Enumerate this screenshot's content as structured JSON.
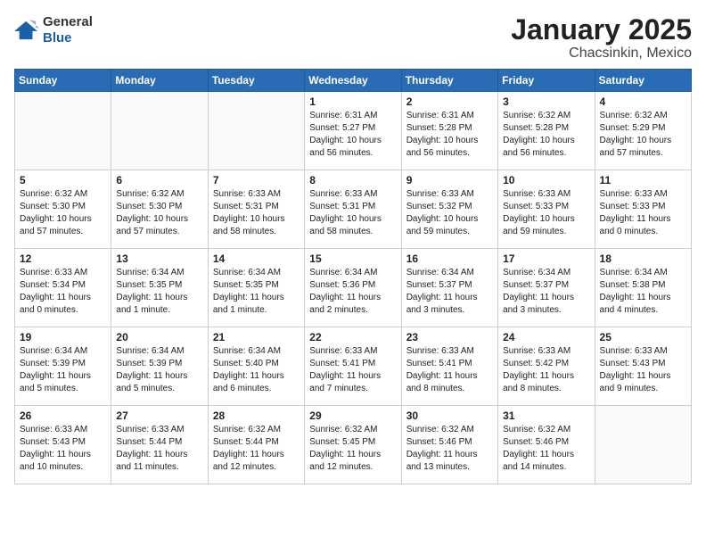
{
  "logo": {
    "general": "General",
    "blue": "Blue"
  },
  "header": {
    "month": "January 2025",
    "location": "Chacsinkin, Mexico"
  },
  "weekdays": [
    "Sunday",
    "Monday",
    "Tuesday",
    "Wednesday",
    "Thursday",
    "Friday",
    "Saturday"
  ],
  "weeks": [
    [
      {
        "day": "",
        "sunrise": "",
        "sunset": "",
        "daylight": ""
      },
      {
        "day": "",
        "sunrise": "",
        "sunset": "",
        "daylight": ""
      },
      {
        "day": "",
        "sunrise": "",
        "sunset": "",
        "daylight": ""
      },
      {
        "day": "1",
        "sunrise": "Sunrise: 6:31 AM",
        "sunset": "Sunset: 5:27 PM",
        "daylight": "Daylight: 10 hours and 56 minutes."
      },
      {
        "day": "2",
        "sunrise": "Sunrise: 6:31 AM",
        "sunset": "Sunset: 5:28 PM",
        "daylight": "Daylight: 10 hours and 56 minutes."
      },
      {
        "day": "3",
        "sunrise": "Sunrise: 6:32 AM",
        "sunset": "Sunset: 5:28 PM",
        "daylight": "Daylight: 10 hours and 56 minutes."
      },
      {
        "day": "4",
        "sunrise": "Sunrise: 6:32 AM",
        "sunset": "Sunset: 5:29 PM",
        "daylight": "Daylight: 10 hours and 57 minutes."
      }
    ],
    [
      {
        "day": "5",
        "sunrise": "Sunrise: 6:32 AM",
        "sunset": "Sunset: 5:30 PM",
        "daylight": "Daylight: 10 hours and 57 minutes."
      },
      {
        "day": "6",
        "sunrise": "Sunrise: 6:32 AM",
        "sunset": "Sunset: 5:30 PM",
        "daylight": "Daylight: 10 hours and 57 minutes."
      },
      {
        "day": "7",
        "sunrise": "Sunrise: 6:33 AM",
        "sunset": "Sunset: 5:31 PM",
        "daylight": "Daylight: 10 hours and 58 minutes."
      },
      {
        "day": "8",
        "sunrise": "Sunrise: 6:33 AM",
        "sunset": "Sunset: 5:31 PM",
        "daylight": "Daylight: 10 hours and 58 minutes."
      },
      {
        "day": "9",
        "sunrise": "Sunrise: 6:33 AM",
        "sunset": "Sunset: 5:32 PM",
        "daylight": "Daylight: 10 hours and 59 minutes."
      },
      {
        "day": "10",
        "sunrise": "Sunrise: 6:33 AM",
        "sunset": "Sunset: 5:33 PM",
        "daylight": "Daylight: 10 hours and 59 minutes."
      },
      {
        "day": "11",
        "sunrise": "Sunrise: 6:33 AM",
        "sunset": "Sunset: 5:33 PM",
        "daylight": "Daylight: 11 hours and 0 minutes."
      }
    ],
    [
      {
        "day": "12",
        "sunrise": "Sunrise: 6:33 AM",
        "sunset": "Sunset: 5:34 PM",
        "daylight": "Daylight: 11 hours and 0 minutes."
      },
      {
        "day": "13",
        "sunrise": "Sunrise: 6:34 AM",
        "sunset": "Sunset: 5:35 PM",
        "daylight": "Daylight: 11 hours and 1 minute."
      },
      {
        "day": "14",
        "sunrise": "Sunrise: 6:34 AM",
        "sunset": "Sunset: 5:35 PM",
        "daylight": "Daylight: 11 hours and 1 minute."
      },
      {
        "day": "15",
        "sunrise": "Sunrise: 6:34 AM",
        "sunset": "Sunset: 5:36 PM",
        "daylight": "Daylight: 11 hours and 2 minutes."
      },
      {
        "day": "16",
        "sunrise": "Sunrise: 6:34 AM",
        "sunset": "Sunset: 5:37 PM",
        "daylight": "Daylight: 11 hours and 3 minutes."
      },
      {
        "day": "17",
        "sunrise": "Sunrise: 6:34 AM",
        "sunset": "Sunset: 5:37 PM",
        "daylight": "Daylight: 11 hours and 3 minutes."
      },
      {
        "day": "18",
        "sunrise": "Sunrise: 6:34 AM",
        "sunset": "Sunset: 5:38 PM",
        "daylight": "Daylight: 11 hours and 4 minutes."
      }
    ],
    [
      {
        "day": "19",
        "sunrise": "Sunrise: 6:34 AM",
        "sunset": "Sunset: 5:39 PM",
        "daylight": "Daylight: 11 hours and 5 minutes."
      },
      {
        "day": "20",
        "sunrise": "Sunrise: 6:34 AM",
        "sunset": "Sunset: 5:39 PM",
        "daylight": "Daylight: 11 hours and 5 minutes."
      },
      {
        "day": "21",
        "sunrise": "Sunrise: 6:34 AM",
        "sunset": "Sunset: 5:40 PM",
        "daylight": "Daylight: 11 hours and 6 minutes."
      },
      {
        "day": "22",
        "sunrise": "Sunrise: 6:33 AM",
        "sunset": "Sunset: 5:41 PM",
        "daylight": "Daylight: 11 hours and 7 minutes."
      },
      {
        "day": "23",
        "sunrise": "Sunrise: 6:33 AM",
        "sunset": "Sunset: 5:41 PM",
        "daylight": "Daylight: 11 hours and 8 minutes."
      },
      {
        "day": "24",
        "sunrise": "Sunrise: 6:33 AM",
        "sunset": "Sunset: 5:42 PM",
        "daylight": "Daylight: 11 hours and 8 minutes."
      },
      {
        "day": "25",
        "sunrise": "Sunrise: 6:33 AM",
        "sunset": "Sunset: 5:43 PM",
        "daylight": "Daylight: 11 hours and 9 minutes."
      }
    ],
    [
      {
        "day": "26",
        "sunrise": "Sunrise: 6:33 AM",
        "sunset": "Sunset: 5:43 PM",
        "daylight": "Daylight: 11 hours and 10 minutes."
      },
      {
        "day": "27",
        "sunrise": "Sunrise: 6:33 AM",
        "sunset": "Sunset: 5:44 PM",
        "daylight": "Daylight: 11 hours and 11 minutes."
      },
      {
        "day": "28",
        "sunrise": "Sunrise: 6:32 AM",
        "sunset": "Sunset: 5:44 PM",
        "daylight": "Daylight: 11 hours and 12 minutes."
      },
      {
        "day": "29",
        "sunrise": "Sunrise: 6:32 AM",
        "sunset": "Sunset: 5:45 PM",
        "daylight": "Daylight: 11 hours and 12 minutes."
      },
      {
        "day": "30",
        "sunrise": "Sunrise: 6:32 AM",
        "sunset": "Sunset: 5:46 PM",
        "daylight": "Daylight: 11 hours and 13 minutes."
      },
      {
        "day": "31",
        "sunrise": "Sunrise: 6:32 AM",
        "sunset": "Sunset: 5:46 PM",
        "daylight": "Daylight: 11 hours and 14 minutes."
      },
      {
        "day": "",
        "sunrise": "",
        "sunset": "",
        "daylight": ""
      }
    ]
  ]
}
